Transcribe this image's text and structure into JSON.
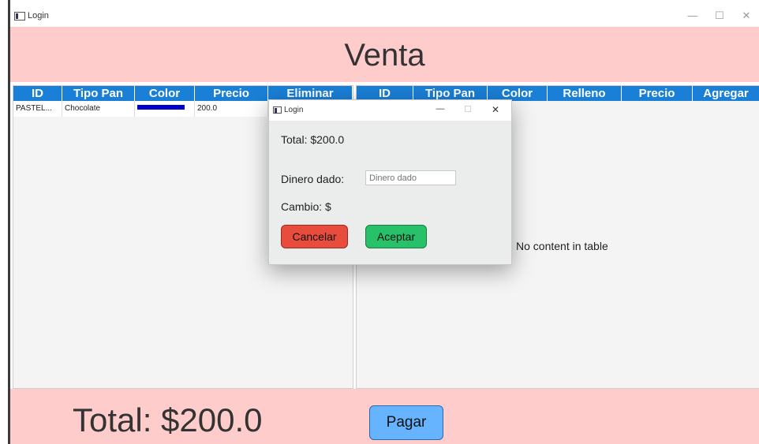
{
  "window": {
    "title": "Login",
    "minimize": "—",
    "maximize": "☐",
    "close": "✕"
  },
  "header": {
    "title": "Venta"
  },
  "left_table": {
    "columns": [
      "ID",
      "Tipo Pan",
      "Color",
      "Precio",
      "Eliminar"
    ],
    "rows": [
      {
        "id": "PASTEL...",
        "tipo_pan": "Chocolate",
        "color": "#0000cc",
        "precio": "200.0",
        "eliminar": ""
      }
    ]
  },
  "right_table": {
    "columns": [
      "ID",
      "Tipo Pan",
      "Color",
      "Relleno",
      "Precio",
      "Agregar"
    ],
    "empty_message": "No content in table"
  },
  "footer": {
    "total": "Total: $200.0",
    "pay_button": "Pagar"
  },
  "dialog": {
    "title": "Login",
    "minimize": "—",
    "maximize": "☐",
    "close": "✕",
    "total": "Total: $200.0",
    "money_label": "Dinero dado:",
    "money_placeholder": "Dinero dado",
    "change_label": "Cambio: $",
    "cancel_button": "Cancelar",
    "accept_button": "Aceptar"
  },
  "colors": {
    "header_bg": "#ffcccc",
    "table_header": "#1a7fd6",
    "cancel": "#e74c3c",
    "accept": "#27c16a",
    "pay": "#66b3ff"
  }
}
